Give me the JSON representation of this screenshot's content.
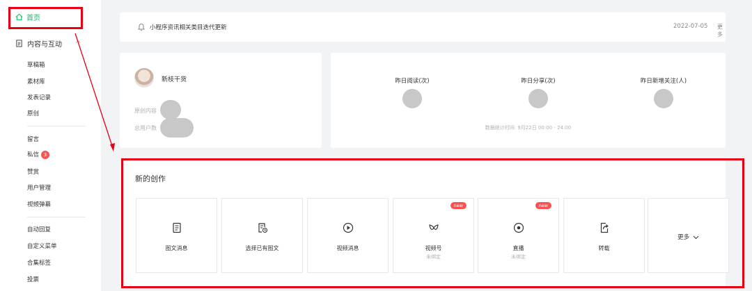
{
  "sidebar": {
    "home_label": "首页",
    "content_section_label": "内容与互动",
    "group1": [
      "草稿箱",
      "素材库",
      "发表记录",
      "原创"
    ],
    "group2": [
      "留言",
      "私信",
      "赞赏",
      "用户管理",
      "视频弹幕"
    ],
    "group3": [
      "自动回复",
      "自定义菜单",
      "合集标签",
      "投票"
    ],
    "message_badge": "3"
  },
  "notice": {
    "text": "小程序资讯相关类目迭代更新",
    "date": "2022-07-05",
    "more": "更多"
  },
  "profile": {
    "name": "新枝干货",
    "original_label": "原创内容",
    "users_label": "总用户数"
  },
  "stats": {
    "reads_label": "昨日阅读(次)",
    "shares_label": "昨日分享(次)",
    "follows_label": "昨日新增关注(人)",
    "time_text": "数据统计时间: 9月22日 00:00 - 24:00"
  },
  "create": {
    "title": "新的创作",
    "tiles": [
      {
        "label": "图文消息",
        "sub": "",
        "tag": "",
        "icon": "document-icon"
      },
      {
        "label": "选择已有图文",
        "sub": "",
        "tag": "",
        "icon": "document-clock-icon"
      },
      {
        "label": "视频消息",
        "sub": "",
        "tag": "",
        "icon": "play-icon"
      },
      {
        "label": "视频号",
        "sub": "未绑定",
        "tag": "new",
        "icon": "channels-icon"
      },
      {
        "label": "直播",
        "sub": "未绑定",
        "tag": "new",
        "icon": "live-icon"
      },
      {
        "label": "转载",
        "sub": "",
        "tag": "",
        "icon": "repost-icon"
      }
    ],
    "more_label": "更多"
  },
  "colors": {
    "accent": "#07c160",
    "annotation_red": "#e60012",
    "badge_red": "#fa5151"
  }
}
